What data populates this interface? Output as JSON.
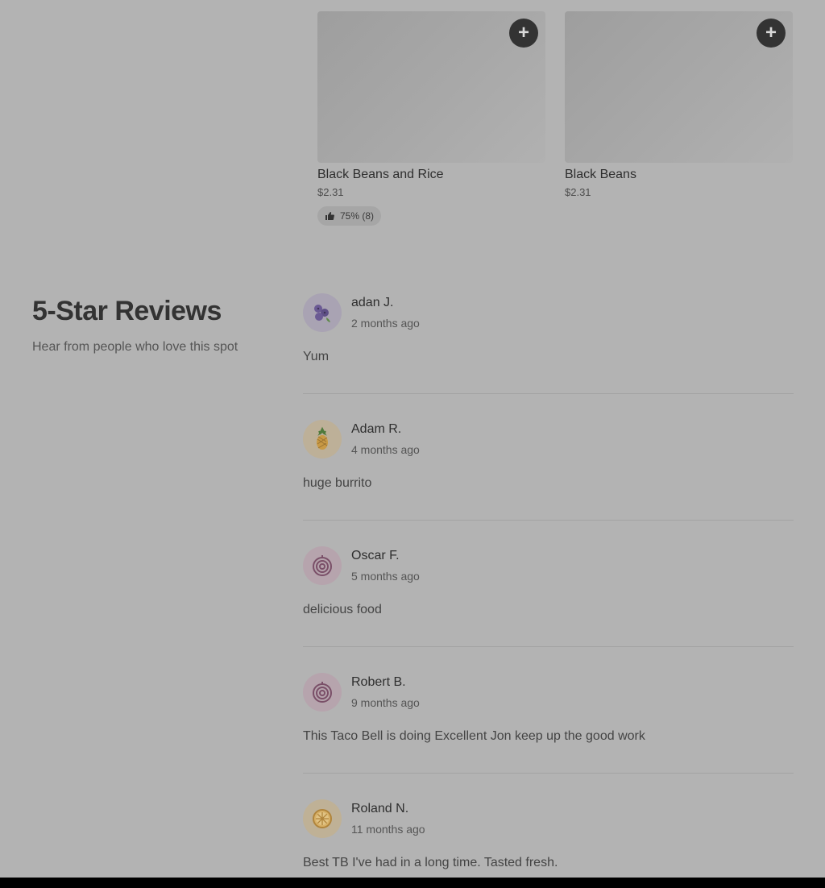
{
  "products": [
    {
      "name": "Black Beans and Rice",
      "price": "$2.31",
      "rating": "75% (8)",
      "add_label": "+"
    },
    {
      "name": "Black Beans",
      "price": "$2.31",
      "add_label": "+"
    }
  ],
  "reviews_section": {
    "title": "5-Star Reviews",
    "subtitle": "Hear from people who love this spot"
  },
  "reviews": [
    {
      "name": "adan J.",
      "time": "2 months ago",
      "text": "Yum",
      "avatar_icon": "blueberry-icon"
    },
    {
      "name": "Adam R.",
      "time": "4 months ago",
      "text": "huge burrito",
      "avatar_icon": "pineapple-icon"
    },
    {
      "name": "Oscar F.",
      "time": "5 months ago",
      "text": "delicious food",
      "avatar_icon": "onion-icon"
    },
    {
      "name": "Robert B.",
      "time": "9 months ago",
      "text": "This Taco Bell is doing Excellent Jon keep up the good work",
      "avatar_icon": "onion-icon"
    },
    {
      "name": "Roland N.",
      "time": "11 months ago",
      "text": "Best TB I've had in a long time. Tasted fresh.",
      "avatar_icon": "orange-slice-icon"
    }
  ],
  "colors": {
    "overlay_bg": "#b3b3b3",
    "add_button": "#333333",
    "divider": "#a3a3a3"
  }
}
